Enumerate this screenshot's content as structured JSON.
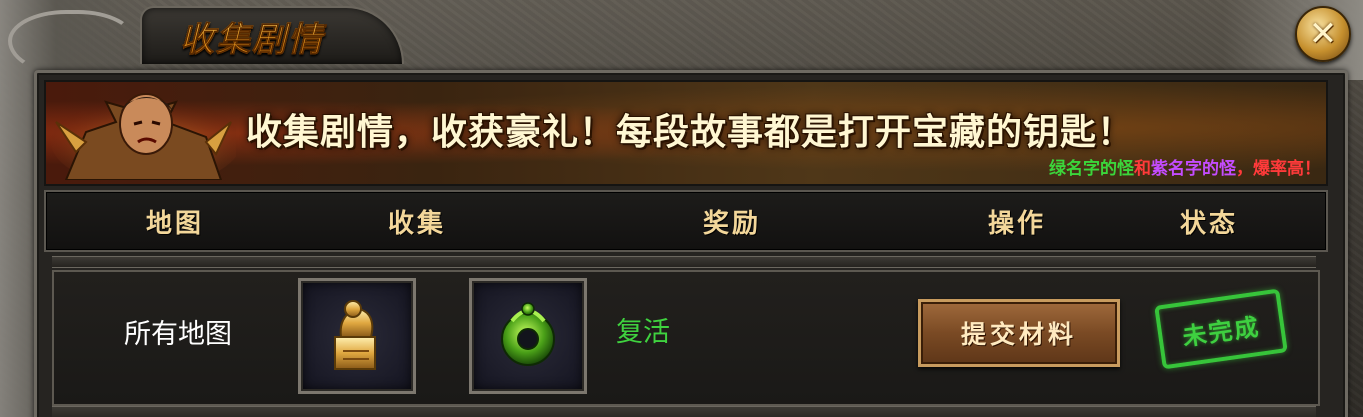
{
  "window": {
    "title": "收集剧情",
    "close_icon": "close-x-icon"
  },
  "banner": {
    "headline": "收集剧情，收获豪礼！每段故事都是打开宝藏的钥匙！",
    "sub_part1": "绿名字的怪",
    "sub_part2": "和",
    "sub_part3": "紫名字的怪",
    "sub_part4": "，爆率高！",
    "colors": {
      "green": "#3bd63b",
      "red": "#ff3a3a",
      "purple": "#c44cff"
    }
  },
  "table": {
    "columns": {
      "map": "地图",
      "collect": "收集",
      "reward": "奖励",
      "action": "操作",
      "status": "状态"
    },
    "rows": [
      {
        "map": "所有地图",
        "items": [
          {
            "icon": "golden-seal-icon"
          },
          {
            "icon": "jade-ring-icon"
          }
        ],
        "reward": "复活",
        "action": "提交材料",
        "status": "未完成"
      }
    ]
  },
  "colors": {
    "title_gold": "#f0a020",
    "header_text": "#f3d79a",
    "reward_green": "#3fd23f",
    "status_green": "#37c43a"
  }
}
